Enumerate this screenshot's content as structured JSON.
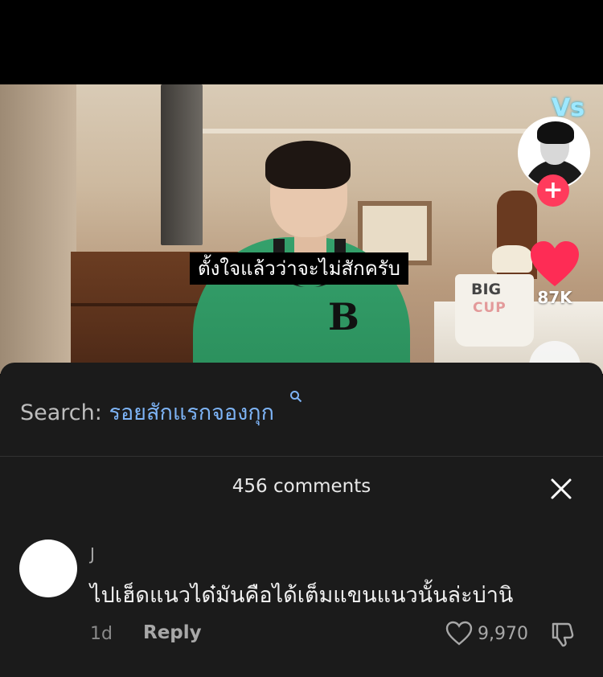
{
  "video": {
    "subtitle": "ตั้งใจแล้วว่าจะไม่สักครับ",
    "sticker_text": "Vs",
    "cup_text": [
      "BIG",
      "CUP"
    ],
    "like_count": "87K"
  },
  "search": {
    "label": "Search:",
    "term": "รอยสักแรกจองกุก"
  },
  "comments_header": {
    "title": "456 comments"
  },
  "comment": {
    "username": "J",
    "text": "ไปเฮ็ดแนวได๋มันคือได้เต็มแขนแนวนั้นล่ะบ่านิ",
    "time": "1d",
    "reply_label": "Reply",
    "likes": "9,970"
  },
  "colors": {
    "sheet_bg": "#1b1b1b",
    "search_term": "#7db3f5",
    "follow_plus": "#ff3b5c",
    "heart": "#fe2c55"
  }
}
